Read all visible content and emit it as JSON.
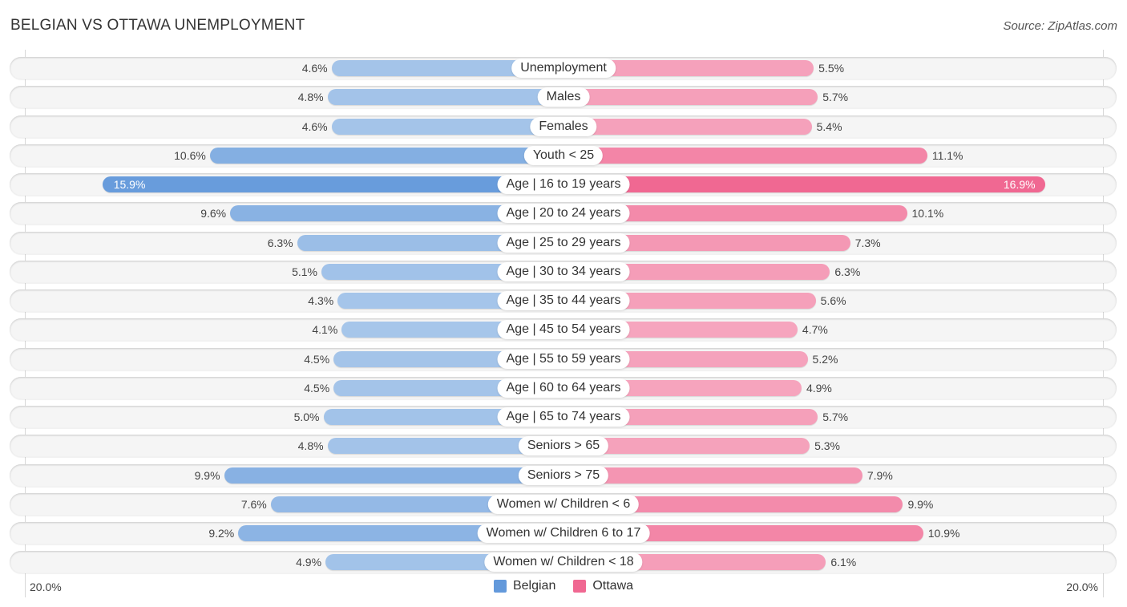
{
  "header": {
    "title": "BELGIAN VS OTTAWA UNEMPLOYMENT",
    "source": "Source: ZipAtlas.com"
  },
  "colors": {
    "belgian_strong": "#6399db",
    "belgian_light": "#a7c6ea",
    "ottawa_strong": "#f06892",
    "ottawa_light": "#f6a8c0"
  },
  "axis": {
    "left_label": "20.0%",
    "right_label": "20.0%"
  },
  "legend": {
    "items": [
      {
        "label": "Belgian",
        "color": "#6399db"
      },
      {
        "label": "Ottawa",
        "color": "#f06892"
      }
    ]
  },
  "chart_data": {
    "type": "bar",
    "orientation": "horizontal-diverging",
    "title": "BELGIAN VS OTTAWA UNEMPLOYMENT",
    "source": "Source: ZipAtlas.com",
    "xlabel": "",
    "ylabel": "",
    "xlim": [
      0,
      20.0
    ],
    "axis_tick_labels": [
      "20.0%",
      "20.0%"
    ],
    "legend_position": "bottom-center",
    "grid": false,
    "categories": [
      "Unemployment",
      "Males",
      "Females",
      "Youth < 25",
      "Age | 16 to 19 years",
      "Age | 20 to 24 years",
      "Age | 25 to 29 years",
      "Age | 30 to 34 years",
      "Age | 35 to 44 years",
      "Age | 45 to 54 years",
      "Age | 55 to 59 years",
      "Age | 60 to 64 years",
      "Age | 65 to 74 years",
      "Seniors > 65",
      "Seniors > 75",
      "Women w/ Children < 6",
      "Women w/ Children 6 to 17",
      "Women w/ Children < 18"
    ],
    "series": [
      {
        "name": "Belgian",
        "side": "left",
        "color": "#6399db",
        "values": [
          4.6,
          4.8,
          4.6,
          10.6,
          15.9,
          9.6,
          6.3,
          5.1,
          4.3,
          4.1,
          4.5,
          4.5,
          5.0,
          4.8,
          9.9,
          7.6,
          9.2,
          4.9
        ],
        "labels": [
          "4.6%",
          "4.8%",
          "4.6%",
          "10.6%",
          "15.9%",
          "9.6%",
          "6.3%",
          "5.1%",
          "4.3%",
          "4.1%",
          "4.5%",
          "4.5%",
          "5.0%",
          "4.8%",
          "9.9%",
          "7.6%",
          "9.2%",
          "4.9%"
        ]
      },
      {
        "name": "Ottawa",
        "side": "right",
        "color": "#f06892",
        "values": [
          5.5,
          5.7,
          5.4,
          11.1,
          16.9,
          10.1,
          7.3,
          6.3,
          5.6,
          4.7,
          5.2,
          4.9,
          5.7,
          5.3,
          7.9,
          9.9,
          10.9,
          6.1
        ],
        "labels": [
          "5.5%",
          "5.7%",
          "5.4%",
          "11.1%",
          "16.9%",
          "10.1%",
          "7.3%",
          "6.3%",
          "5.6%",
          "4.7%",
          "5.2%",
          "4.9%",
          "5.7%",
          "5.3%",
          "7.9%",
          "9.9%",
          "10.9%",
          "6.1%"
        ]
      }
    ]
  }
}
